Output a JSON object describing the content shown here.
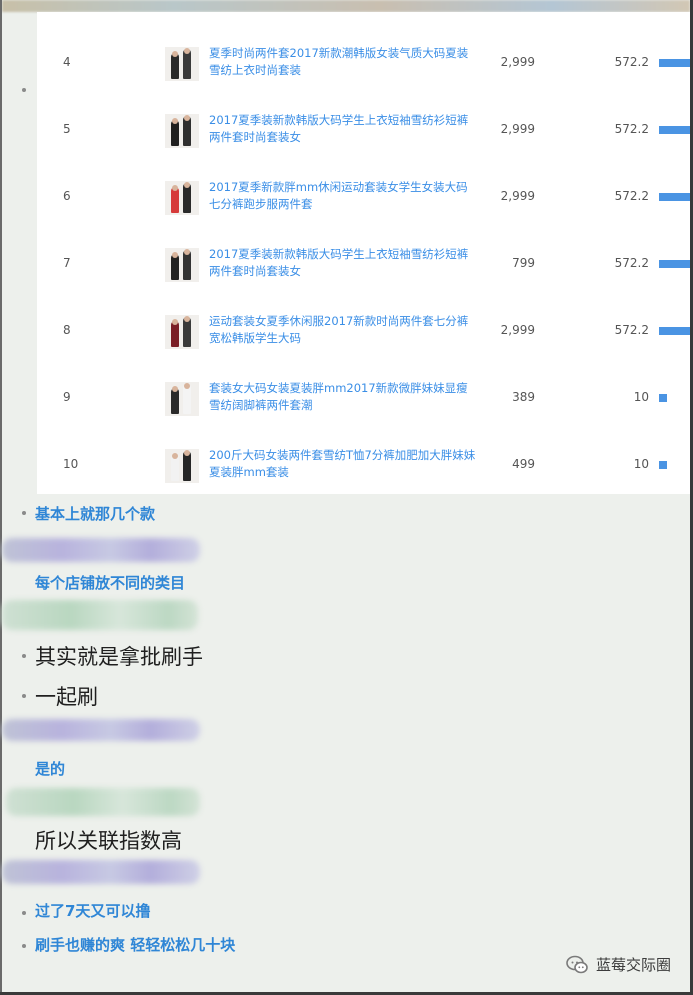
{
  "table": {
    "rows": [
      {
        "rank": "4",
        "title": "夏季时尚两件套2017新款潮韩版女装气质大码夏装雪纺上衣时尚套装",
        "price": "2,999",
        "index": "572.2",
        "bar": 1.0,
        "thumb": [
          "#2a2a2a",
          "#3a3a3a"
        ]
      },
      {
        "rank": "5",
        "title": "2017夏季装新款韩版大码学生上衣短袖雪纺衫短裤两件套时尚套装女",
        "price": "2,999",
        "index": "572.2",
        "bar": 1.0,
        "thumb": [
          "#202020",
          "#2f2f2f"
        ]
      },
      {
        "rank": "6",
        "title": "2017夏季新款胖mm休闲运动套装女学生女装大码七分裤跑步服两件套",
        "price": "2,999",
        "index": "572.2",
        "bar": 1.0,
        "thumb": [
          "#d63a3a",
          "#2a2a2a"
        ]
      },
      {
        "rank": "7",
        "title": "2017夏季装新款韩版大码学生上衣短袖雪纺衫短裤两件套时尚套装女",
        "price": "799",
        "index": "572.2",
        "bar": 1.0,
        "thumb": [
          "#222222",
          "#333333"
        ]
      },
      {
        "rank": "8",
        "title": "运动套装女夏季休闲服2017新款时尚两件套七分裤宽松韩版学生大码",
        "price": "2,999",
        "index": "572.2",
        "bar": 1.0,
        "thumb": [
          "#7a1e26",
          "#3a3a3a"
        ]
      },
      {
        "rank": "9",
        "title": "套装女大码女装夏装胖mm2017新款微胖妹妹显瘦雪纺阔脚裤两件套潮",
        "price": "389",
        "index": "10",
        "bar": 0.25,
        "thumb": [
          "#2a2a2a",
          "#f4f4f4"
        ]
      },
      {
        "rank": "10",
        "title": "200斤大码女装两件套雪纺T恤7分裤加肥加大胖妹妹夏装胖mm套装",
        "price": "499",
        "index": "10",
        "bar": 0.25,
        "thumb": [
          "#f2f2f2",
          "#262626"
        ]
      }
    ]
  },
  "chat": {
    "msg1": "基本上就那几个款",
    "msg2": "每个店铺放不同的类目",
    "msg3": "其实就是拿批刷手",
    "msg4": "一起刷",
    "msg5": "是的",
    "msg6": "所以关联指数高",
    "msg7": "过了7天又可以撸",
    "msg8": "刷手也赚的爽 轻轻松松几十块"
  },
  "watermark": {
    "text": "蓝莓交际圈",
    "icon": "wechat-channel-icon"
  },
  "colors": {
    "link": "#3a8ee6",
    "bar": "#4a94e3",
    "chat_blue": "#2f86d6"
  }
}
